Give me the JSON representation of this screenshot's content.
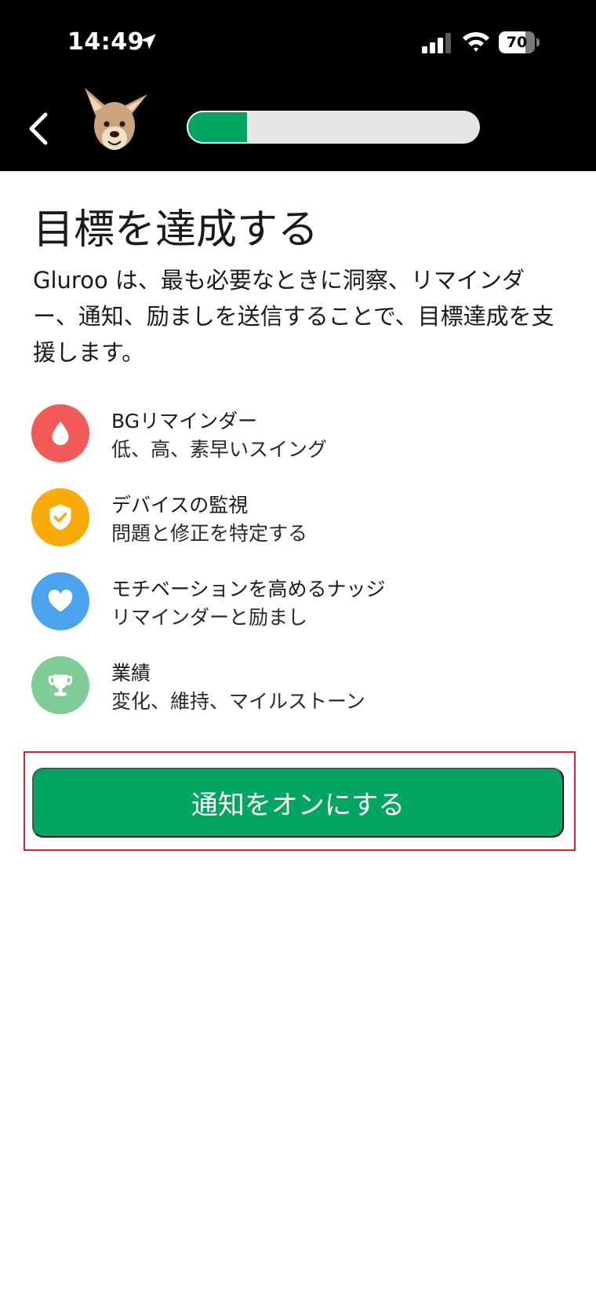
{
  "status_bar": {
    "time": "14:49",
    "battery": "70",
    "icons": [
      "location-arrow-icon",
      "cellular-signal-icon",
      "wifi-icon",
      "battery-icon"
    ]
  },
  "header": {
    "back_icon": "chevron-left-icon",
    "mascot": "kangaroo-mascot",
    "progress": 0.21,
    "progress_color": "#00a562"
  },
  "main": {
    "title": "目標を達成する",
    "description": "Gluroo は、最も必要なときに洞察、リマインダー、通知、励ましを送信することで、目標達成を支援します。",
    "features": [
      {
        "icon": "droplet-icon",
        "color": "#f25a5a",
        "title": "BGリマインダー",
        "subtitle": "低、高、素早いスイング"
      },
      {
        "icon": "shield-check-icon",
        "color": "#f8ab0a",
        "title": "デバイスの監視",
        "subtitle": "問題と修正を特定する"
      },
      {
        "icon": "heart-icon",
        "color": "#4aa3ec",
        "title": "モチベーションを高めるナッジ",
        "subtitle": "リマインダーと励まし"
      },
      {
        "icon": "trophy-icon",
        "color": "#7fcc97",
        "title": "業績",
        "subtitle": "変化、維持、マイルストーン"
      }
    ],
    "cta_label": "通知をオンにする",
    "cta_color": "#00a562"
  }
}
